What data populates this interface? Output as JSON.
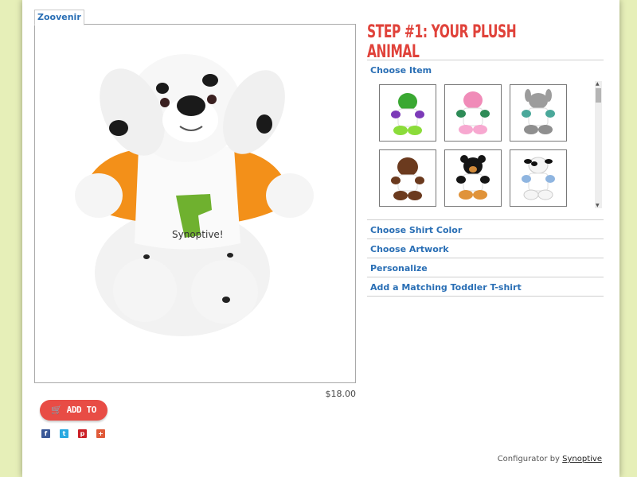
{
  "product": {
    "tab_label": "Zoovenir",
    "price": "$18.00",
    "shirt_text": "Synoptive!"
  },
  "cart": {
    "label": "ADD TO CART"
  },
  "social": [
    "facebook-icon",
    "twitter-icon",
    "pinterest-icon",
    "google-plus-icon"
  ],
  "step_title": "STEP #1: YOUR PLUSH ANIMAL",
  "accordion": {
    "choose_item": "Choose Item",
    "choose_shirt_color": "Choose Shirt Color",
    "choose_artwork": "Choose Artwork",
    "personalize": "Personalize",
    "toddler_shirt": "Add a Matching Toddler T-shirt"
  },
  "items": [
    "green-alligator",
    "pink-pig",
    "gray-donkey",
    "brown-monkey",
    "black-bear",
    "cow"
  ],
  "footer": {
    "prefix": "Configurator by",
    "link": "Synoptive"
  },
  "colors": {
    "accent": "#2a6fb5",
    "title_red": "#e0423a",
    "background": "#e6efb8",
    "shirt_sleeve": "#f39019"
  }
}
